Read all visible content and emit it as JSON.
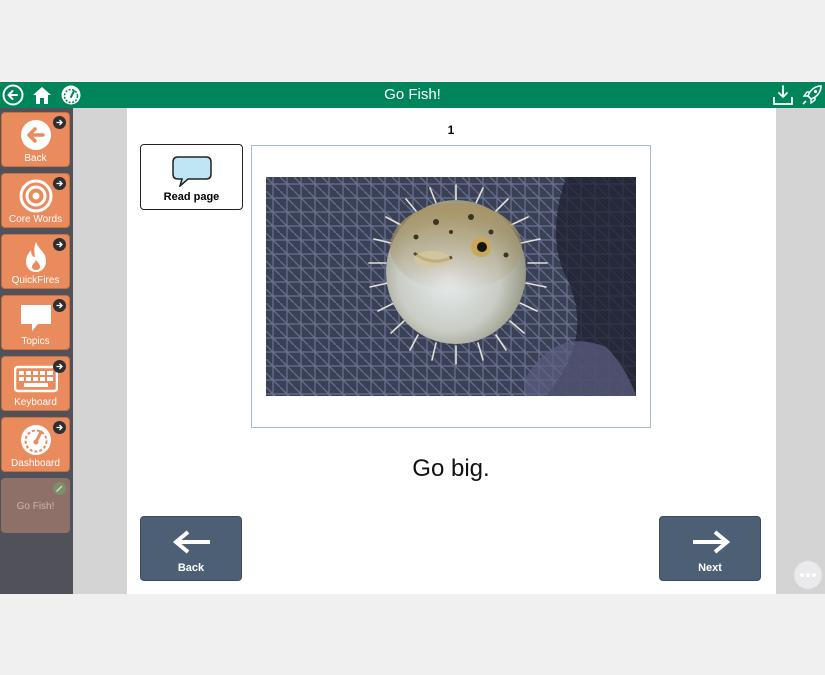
{
  "window": {
    "title": "Go Fish!"
  },
  "toolbar": {
    "left_icons": [
      "back-circle-icon",
      "home-icon",
      "dashboard-icon"
    ],
    "right_icons": [
      "download-icon",
      "rocket-icon"
    ]
  },
  "sidebar": {
    "items": [
      {
        "label": "Back",
        "icon": "back-arrow-icon"
      },
      {
        "label": "Core Words",
        "icon": "target-icon"
      },
      {
        "label": "QuickFires",
        "icon": "flame-icon"
      },
      {
        "label": "Topics",
        "icon": "speech-bubble-icon"
      },
      {
        "label": "Keyboard",
        "icon": "keyboard-icon"
      },
      {
        "label": "Dashboard",
        "icon": "gauge-icon"
      },
      {
        "label": "Go Fish!",
        "icon": "pencil-icon",
        "disabled": true
      }
    ]
  },
  "book": {
    "page_number": "1",
    "read_page_label": "Read page",
    "caption": "Go big.",
    "back_label": "Back",
    "next_label": "Next"
  },
  "colors": {
    "titlebar": "#00845a",
    "sidebar_bg": "#515159",
    "sidebar_tile": "#e98b5c",
    "nav_button": "#4c5f75",
    "photo_frame": "#a6bccd"
  }
}
